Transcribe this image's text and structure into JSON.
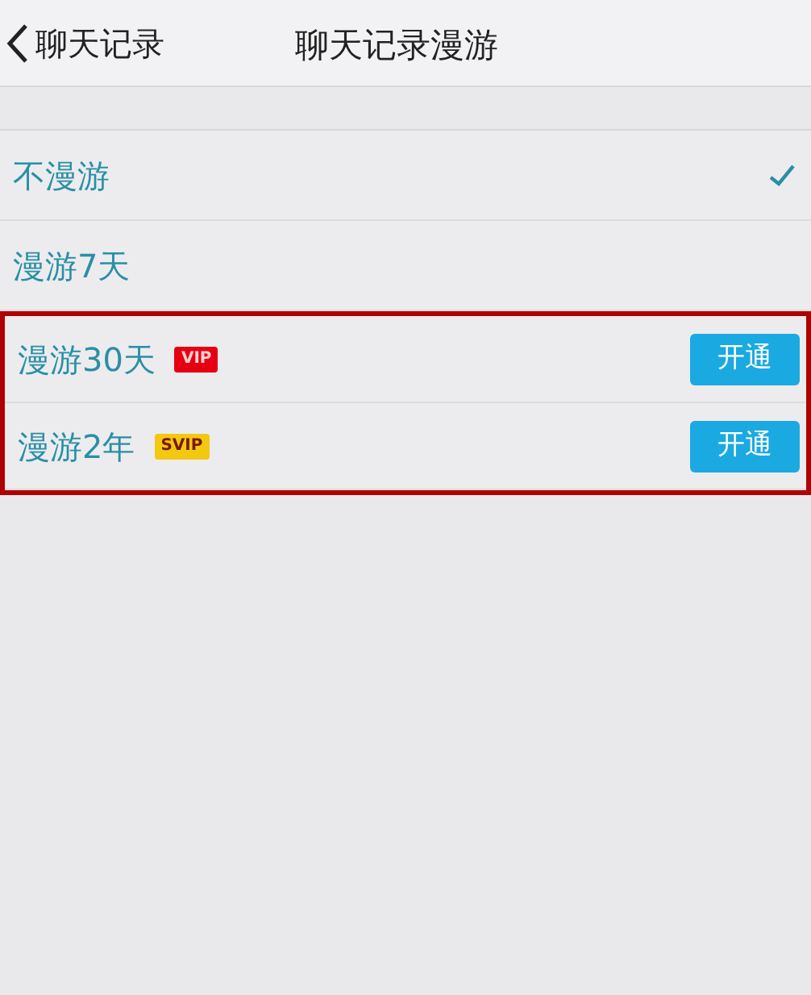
{
  "nav_bar": {
    "back_label": "聊天记录",
    "title": "聊天记录漫游"
  },
  "options": [
    {
      "label": "不漫游",
      "selected": true,
      "highlighted": false
    },
    {
      "label": "漫游7天",
      "selected": false,
      "highlighted": false
    },
    {
      "label": "漫游30天",
      "selected": false,
      "highlighted": true,
      "badge": {
        "text": "VIP",
        "color": "#e60012"
      },
      "button": "开通"
    },
    {
      "label": "漫游2年",
      "selected": false,
      "highlighted": true,
      "badge": {
        "text": "SVIP",
        "color": "#f2c811"
      },
      "button": "开通"
    }
  ]
}
